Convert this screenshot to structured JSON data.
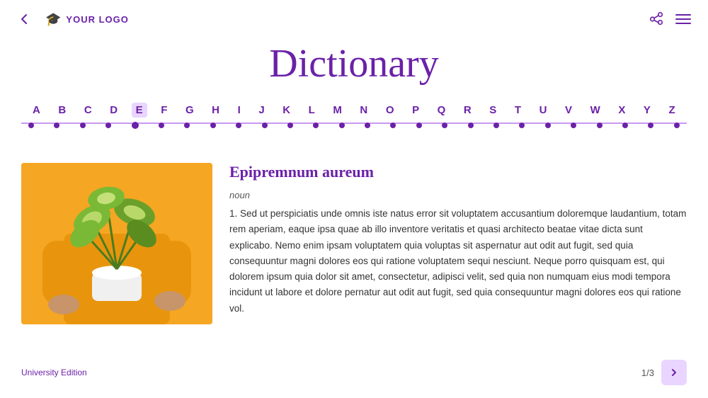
{
  "header": {
    "back_label": "←",
    "logo_text": "YOUR LOGO",
    "logo_icon": "🎓"
  },
  "title": "Dictionary",
  "alphabet": {
    "letters": [
      "A",
      "B",
      "C",
      "D",
      "E",
      "F",
      "G",
      "H",
      "I",
      "J",
      "K",
      "L",
      "M",
      "N",
      "O",
      "P",
      "Q",
      "R",
      "S",
      "T",
      "U",
      "V",
      "W",
      "X",
      "Y",
      "Z"
    ],
    "active": "E"
  },
  "entry": {
    "word": "Epipremnum aureum",
    "type": "noun",
    "definition": "1. Sed ut perspiciatis unde omnis iste natus error sit voluptatem accusantium doloremque laudantium, totam rem aperiam, eaque ipsa quae ab illo inventore veritatis et quasi architecto beatae vitae dicta sunt explicabo. Nemo enim ipsam voluptatem quia voluptas sit aspernatur aut odit aut fugit, sed quia consequuntur magni dolores eos qui ratione voluptatem sequi nesciunt. Neque porro quisquam est, qui dolorem ipsum quia dolor sit amet, consectetur, adipisci velit, sed quia non numquam eius modi tempora incidunt ut labore et dolore pernatur aut odit aut fugit, sed quia consequuntur magni dolores eos qui ratione vol."
  },
  "footer": {
    "edition_label": "University Edition",
    "page_current": "1",
    "page_total": "3",
    "page_display": "1/3",
    "next_label": "›"
  }
}
